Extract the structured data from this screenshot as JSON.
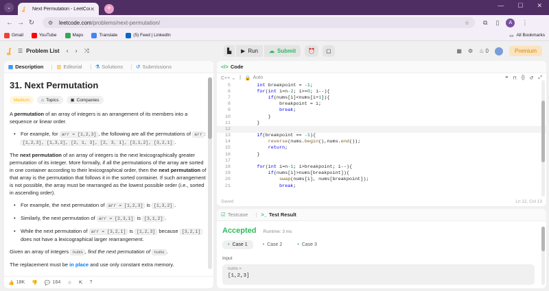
{
  "browser": {
    "tab_title": "Next Permutation - LeetCode",
    "url_host": "leetcode.com",
    "url_path": "/problems/next-permutation/",
    "profile_letter": "A"
  },
  "bookmarks": {
    "items": [
      "Gmail",
      "YouTube",
      "Maps",
      "Translate",
      "(5) Feed | LinkedIn"
    ],
    "all_label": "All Bookmarks"
  },
  "topbar": {
    "problem_list": "Problem List",
    "run": "Run",
    "submit": "Submit",
    "fire_count": "0",
    "premium": "Premium"
  },
  "left": {
    "tabs": [
      "Description",
      "Editorial",
      "Solutions",
      "Submissions"
    ],
    "title": "31. Next Permutation",
    "difficulty": "Medium",
    "tag_topics": "Topics",
    "tag_companies": "Companies",
    "p1_pre": "A ",
    "p1_bold": "permutation",
    "p1_post": " of an array of integers is an arrangement of its members into a sequence or linear order.",
    "ex1_pre": "For example, for ",
    "ex1_code": "arr = [1,2,3]",
    "ex1_post": ", the following are all the permutations of ",
    "ex1_code2": "arr",
    "ex1_list": "[1,2,3], [1,3,2], [2, 1, 3], [2, 3, 1], [3,1,2], [3,2,1]",
    "p2_pre": "The ",
    "p2_bold1": "next permutation",
    "p2_mid": " of an array of integers is the next lexicographically greater permutation of its integer. More formally, if all the permutations of the array are sorted in one container according to their lexicographical order, then the ",
    "p2_bold2": "next permutation",
    "p2_post": " of that array is the permutation that follows it in the sorted container. If such arrangement is not possible, the array must be rearranged as the lowest possible order (i.e., sorted in ascending order).",
    "b1_pre": "For example, the next permutation of ",
    "b1_c1": "arr = [1,2,3]",
    "b1_mid": " is ",
    "b1_c2": "[1,3,2]",
    "b2_pre": "Similarly, the next permutation of ",
    "b2_c1": "arr = [2,3,1]",
    "b2_mid": " is ",
    "b2_c2": "[3,1,2]",
    "b3_pre": "While the next permutation of ",
    "b3_c1": "arr = [3,2,1]",
    "b3_mid": " is ",
    "b3_c2": "[1,2,3]",
    "b3_post1": " because ",
    "b3_c3": "[3,2,1]",
    "b3_post2": " does not have a lexicographical larger rearrangement.",
    "p3_pre": "Given an array of integers ",
    "p3_code": "nums",
    "p3_em": ", find the next permutation of ",
    "p3_code2": "nums",
    "p4_pre": "The replacement must be ",
    "p4_blue": "in place",
    "p4_post": " and use only constant extra memory.",
    "likes": "18K",
    "comments": "164"
  },
  "code": {
    "header": "Code",
    "language": "C++",
    "mode": "Auto",
    "saved": "Saved",
    "cursor": "Ln 12, Col 13",
    "lines": [
      {
        "n": "5",
        "indent": 4,
        "tokens": [
          [
            "kw",
            "int"
          ],
          [
            "txt",
            " breakpoint = "
          ],
          [
            "num",
            "-1"
          ],
          [
            "txt",
            ";"
          ]
        ]
      },
      {
        "n": "6",
        "indent": 4,
        "tokens": [
          [
            "kw",
            "for"
          ],
          [
            "txt",
            "("
          ],
          [
            "kw",
            "int"
          ],
          [
            "txt",
            " i=n"
          ],
          [
            "num",
            "-2"
          ],
          [
            "txt",
            "; i>="
          ],
          [
            "num",
            "0"
          ],
          [
            "txt",
            "; i--){"
          ]
        ]
      },
      {
        "n": "7",
        "indent": 8,
        "tokens": [
          [
            "kw",
            "if"
          ],
          [
            "txt",
            "(nums[i]<nums[i+"
          ],
          [
            "num",
            "1"
          ],
          [
            "txt",
            "]){"
          ]
        ]
      },
      {
        "n": "8",
        "indent": 12,
        "tokens": [
          [
            "txt",
            "breakpoint = i;"
          ]
        ]
      },
      {
        "n": "9",
        "indent": 12,
        "tokens": [
          [
            "kw",
            "break"
          ],
          [
            "txt",
            ";"
          ]
        ]
      },
      {
        "n": "10",
        "indent": 8,
        "tokens": [
          [
            "txt",
            "}"
          ]
        ]
      },
      {
        "n": "11",
        "indent": 4,
        "tokens": [
          [
            "txt",
            "}"
          ]
        ]
      },
      {
        "n": "12",
        "indent": 0,
        "tokens": [
          [
            "txt",
            ""
          ]
        ],
        "current": true
      },
      {
        "n": "13",
        "indent": 4,
        "tokens": [
          [
            "kw",
            "if"
          ],
          [
            "txt",
            "(breakpoint == "
          ],
          [
            "num",
            "-1"
          ],
          [
            "txt",
            "){"
          ]
        ]
      },
      {
        "n": "14",
        "indent": 8,
        "tokens": [
          [
            "fn",
            "reverse"
          ],
          [
            "txt",
            "(nums."
          ],
          [
            "fn",
            "begin"
          ],
          [
            "txt",
            "(),nums."
          ],
          [
            "fn",
            "end"
          ],
          [
            "txt",
            "());"
          ]
        ]
      },
      {
        "n": "15",
        "indent": 8,
        "tokens": [
          [
            "kw",
            "return"
          ],
          [
            "txt",
            ";"
          ]
        ]
      },
      {
        "n": "16",
        "indent": 4,
        "tokens": [
          [
            "txt",
            "}"
          ]
        ]
      },
      {
        "n": "17",
        "indent": 0,
        "tokens": [
          [
            "txt",
            ""
          ]
        ]
      },
      {
        "n": "18",
        "indent": 4,
        "tokens": [
          [
            "kw",
            "for"
          ],
          [
            "txt",
            "("
          ],
          [
            "kw",
            "int"
          ],
          [
            "txt",
            " i=n"
          ],
          [
            "num",
            "-1"
          ],
          [
            "txt",
            "; i>breakpoint; i--){"
          ]
        ]
      },
      {
        "n": "19",
        "indent": 8,
        "tokens": [
          [
            "kw",
            "if"
          ],
          [
            "txt",
            "(nums[i]>nums[breakpoint]){"
          ]
        ]
      },
      {
        "n": "20",
        "indent": 12,
        "tokens": [
          [
            "fn",
            "swap"
          ],
          [
            "txt",
            "(nums[i], nums[breakpoint]);"
          ]
        ]
      },
      {
        "n": "21",
        "indent": 12,
        "tokens": [
          [
            "kw",
            "break"
          ],
          [
            "txt",
            ";"
          ]
        ]
      }
    ]
  },
  "result": {
    "tab_testcase": "Testcase",
    "tab_result": "Test Result",
    "status": "Accepted",
    "runtime": "Runtime: 3 ms",
    "cases": [
      "Case 1",
      "Case 2",
      "Case 3"
    ],
    "input_label": "Input",
    "var_name": "nums =",
    "var_value": "[1,2,3]"
  }
}
